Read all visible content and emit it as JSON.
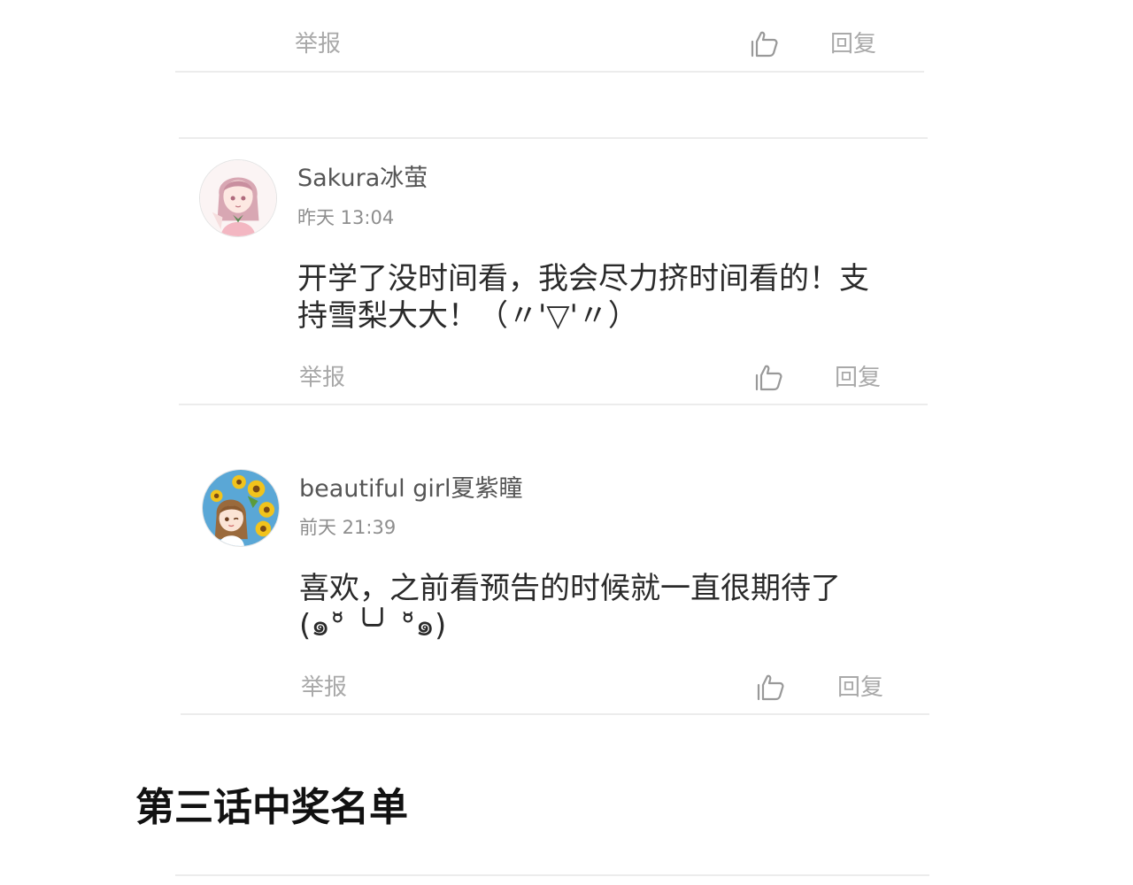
{
  "comments": [
    {
      "report_label": "举报",
      "reply_label": "回复",
      "like_icon": "thumbs-up-outline-icon"
    },
    {
      "username": "Sakura冰萤",
      "timestamp": "昨天 13:04",
      "avatar": "anime-girl-pink-hair-avatar",
      "text_lines": [
        "开学了没时间看，我会尽力挤时间看的！支",
        "持雪梨大大！（〃'▽'〃）"
      ],
      "report_label": "举报",
      "reply_label": "回复",
      "like_icon": "thumbs-up-outline-icon"
    },
    {
      "username": "beautiful girl夏紫瞳",
      "timestamp": "前天 21:39",
      "avatar": "anime-girl-sunflowers-avatar",
      "text_lines": [
        "喜欢，之前看预告的时候就一直很期待了",
        "(๑°̆ ╰╯ °̆๑)"
      ],
      "report_label": "举报",
      "reply_label": "回复",
      "like_icon": "thumbs-up-outline-icon"
    }
  ],
  "section": {
    "title": "第三话中奖名单"
  },
  "colors": {
    "action_gray": "#a9a9a9",
    "divider": "#ececec",
    "username": "#555555",
    "body_text": "#2a2a2a"
  }
}
